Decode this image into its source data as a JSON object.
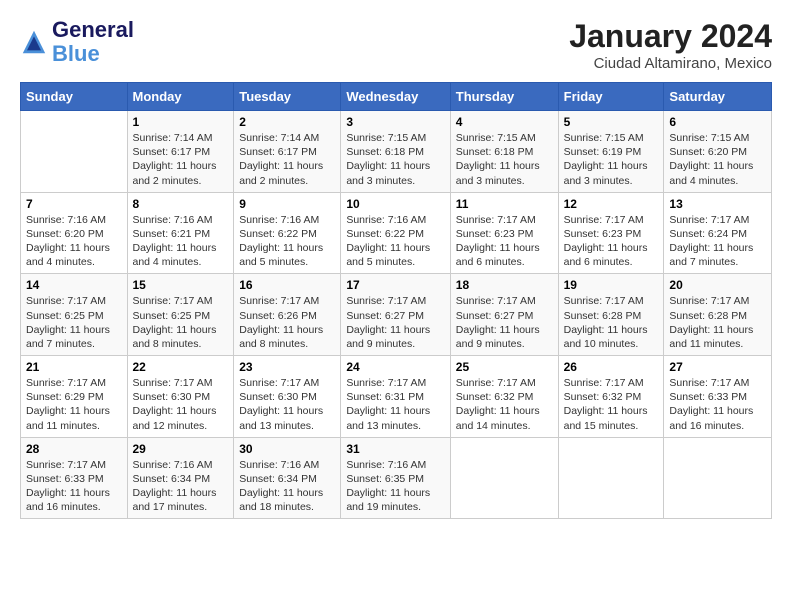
{
  "logo": {
    "line1": "General",
    "line2": "Blue"
  },
  "title": "January 2024",
  "subtitle": "Ciudad Altamirano, Mexico",
  "headers": [
    "Sunday",
    "Monday",
    "Tuesday",
    "Wednesday",
    "Thursday",
    "Friday",
    "Saturday"
  ],
  "weeks": [
    [
      {
        "day": "",
        "sunrise": "",
        "sunset": "",
        "daylight": ""
      },
      {
        "day": "1",
        "sunrise": "7:14 AM",
        "sunset": "6:17 PM",
        "daylight": "11 hours and 2 minutes."
      },
      {
        "day": "2",
        "sunrise": "7:14 AM",
        "sunset": "6:17 PM",
        "daylight": "11 hours and 2 minutes."
      },
      {
        "day": "3",
        "sunrise": "7:15 AM",
        "sunset": "6:18 PM",
        "daylight": "11 hours and 3 minutes."
      },
      {
        "day": "4",
        "sunrise": "7:15 AM",
        "sunset": "6:18 PM",
        "daylight": "11 hours and 3 minutes."
      },
      {
        "day": "5",
        "sunrise": "7:15 AM",
        "sunset": "6:19 PM",
        "daylight": "11 hours and 3 minutes."
      },
      {
        "day": "6",
        "sunrise": "7:15 AM",
        "sunset": "6:20 PM",
        "daylight": "11 hours and 4 minutes."
      }
    ],
    [
      {
        "day": "7",
        "sunrise": "7:16 AM",
        "sunset": "6:20 PM",
        "daylight": "11 hours and 4 minutes."
      },
      {
        "day": "8",
        "sunrise": "7:16 AM",
        "sunset": "6:21 PM",
        "daylight": "11 hours and 4 minutes."
      },
      {
        "day": "9",
        "sunrise": "7:16 AM",
        "sunset": "6:22 PM",
        "daylight": "11 hours and 5 minutes."
      },
      {
        "day": "10",
        "sunrise": "7:16 AM",
        "sunset": "6:22 PM",
        "daylight": "11 hours and 5 minutes."
      },
      {
        "day": "11",
        "sunrise": "7:17 AM",
        "sunset": "6:23 PM",
        "daylight": "11 hours and 6 minutes."
      },
      {
        "day": "12",
        "sunrise": "7:17 AM",
        "sunset": "6:23 PM",
        "daylight": "11 hours and 6 minutes."
      },
      {
        "day": "13",
        "sunrise": "7:17 AM",
        "sunset": "6:24 PM",
        "daylight": "11 hours and 7 minutes."
      }
    ],
    [
      {
        "day": "14",
        "sunrise": "7:17 AM",
        "sunset": "6:25 PM",
        "daylight": "11 hours and 7 minutes."
      },
      {
        "day": "15",
        "sunrise": "7:17 AM",
        "sunset": "6:25 PM",
        "daylight": "11 hours and 8 minutes."
      },
      {
        "day": "16",
        "sunrise": "7:17 AM",
        "sunset": "6:26 PM",
        "daylight": "11 hours and 8 minutes."
      },
      {
        "day": "17",
        "sunrise": "7:17 AM",
        "sunset": "6:27 PM",
        "daylight": "11 hours and 9 minutes."
      },
      {
        "day": "18",
        "sunrise": "7:17 AM",
        "sunset": "6:27 PM",
        "daylight": "11 hours and 9 minutes."
      },
      {
        "day": "19",
        "sunrise": "7:17 AM",
        "sunset": "6:28 PM",
        "daylight": "11 hours and 10 minutes."
      },
      {
        "day": "20",
        "sunrise": "7:17 AM",
        "sunset": "6:28 PM",
        "daylight": "11 hours and 11 minutes."
      }
    ],
    [
      {
        "day": "21",
        "sunrise": "7:17 AM",
        "sunset": "6:29 PM",
        "daylight": "11 hours and 11 minutes."
      },
      {
        "day": "22",
        "sunrise": "7:17 AM",
        "sunset": "6:30 PM",
        "daylight": "11 hours and 12 minutes."
      },
      {
        "day": "23",
        "sunrise": "7:17 AM",
        "sunset": "6:30 PM",
        "daylight": "11 hours and 13 minutes."
      },
      {
        "day": "24",
        "sunrise": "7:17 AM",
        "sunset": "6:31 PM",
        "daylight": "11 hours and 13 minutes."
      },
      {
        "day": "25",
        "sunrise": "7:17 AM",
        "sunset": "6:32 PM",
        "daylight": "11 hours and 14 minutes."
      },
      {
        "day": "26",
        "sunrise": "7:17 AM",
        "sunset": "6:32 PM",
        "daylight": "11 hours and 15 minutes."
      },
      {
        "day": "27",
        "sunrise": "7:17 AM",
        "sunset": "6:33 PM",
        "daylight": "11 hours and 16 minutes."
      }
    ],
    [
      {
        "day": "28",
        "sunrise": "7:17 AM",
        "sunset": "6:33 PM",
        "daylight": "11 hours and 16 minutes."
      },
      {
        "day": "29",
        "sunrise": "7:16 AM",
        "sunset": "6:34 PM",
        "daylight": "11 hours and 17 minutes."
      },
      {
        "day": "30",
        "sunrise": "7:16 AM",
        "sunset": "6:34 PM",
        "daylight": "11 hours and 18 minutes."
      },
      {
        "day": "31",
        "sunrise": "7:16 AM",
        "sunset": "6:35 PM",
        "daylight": "11 hours and 19 minutes."
      },
      {
        "day": "",
        "sunrise": "",
        "sunset": "",
        "daylight": ""
      },
      {
        "day": "",
        "sunrise": "",
        "sunset": "",
        "daylight": ""
      },
      {
        "day": "",
        "sunrise": "",
        "sunset": "",
        "daylight": ""
      }
    ]
  ],
  "labels": {
    "sunrise_prefix": "Sunrise: ",
    "sunset_prefix": "Sunset: ",
    "daylight_prefix": "Daylight: "
  }
}
